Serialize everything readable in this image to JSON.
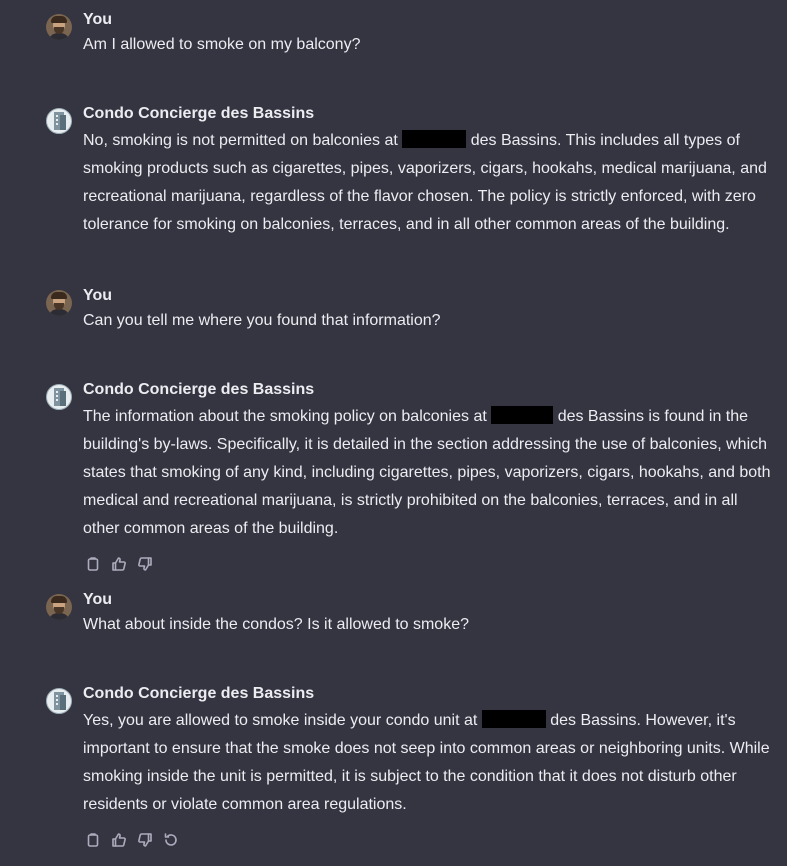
{
  "messages": [
    {
      "sender": "You",
      "role": "user",
      "text": "Am I allowed to smoke on my balcony?"
    },
    {
      "sender": "Condo Concierge des Bassins",
      "role": "assistant",
      "text_before": "No, smoking is not permitted on balconies at ",
      "text_after": "des Bassins. This includes all types of smoking products such as cigarettes, pipes, vaporizers, cigars, hookahs, medical marijuana, and recreational marijuana, regardless of the flavor chosen. The policy is strictly enforced, with zero tolerance for smoking on balconies, terraces, and in all other common areas of the building."
    },
    {
      "sender": "You",
      "role": "user",
      "text": "Can you tell me where you found that information?"
    },
    {
      "sender": "Condo Concierge des Bassins",
      "role": "assistant",
      "text_before": "The information about the smoking policy on balconies at ",
      "text_after": "des Bassins is found in the building's by-laws. Specifically, it is detailed in the section addressing the use of balconies, which states that smoking of any kind, including cigarettes, pipes, vaporizers, cigars, hookahs, and both medical and recreational marijuana, is strictly prohibited on the balconies, terraces, and in all other common areas of the building.",
      "actions": [
        "copy-icon",
        "thumbs-up-icon",
        "thumbs-down-icon"
      ]
    },
    {
      "sender": "You",
      "role": "user",
      "text": "What about inside the condos? Is it allowed to smoke?"
    },
    {
      "sender": "Condo Concierge des Bassins",
      "role": "assistant",
      "text_before": "Yes, you are allowed to smoke inside your condo unit at ",
      "text_after": "des Bassins. However, it's important to ensure that the smoke does not seep into common areas or neighboring units. While smoking inside the unit is permitted, it is subject to the condition that it does not disturb other residents or violate common area regulations.",
      "actions": [
        "copy-icon",
        "thumbs-up-icon",
        "thumbs-down-icon",
        "regenerate-icon"
      ]
    }
  ],
  "colors": {
    "background": "#343541",
    "text": "#ececf1",
    "icon": "#acacbe",
    "redaction": "#000000"
  }
}
